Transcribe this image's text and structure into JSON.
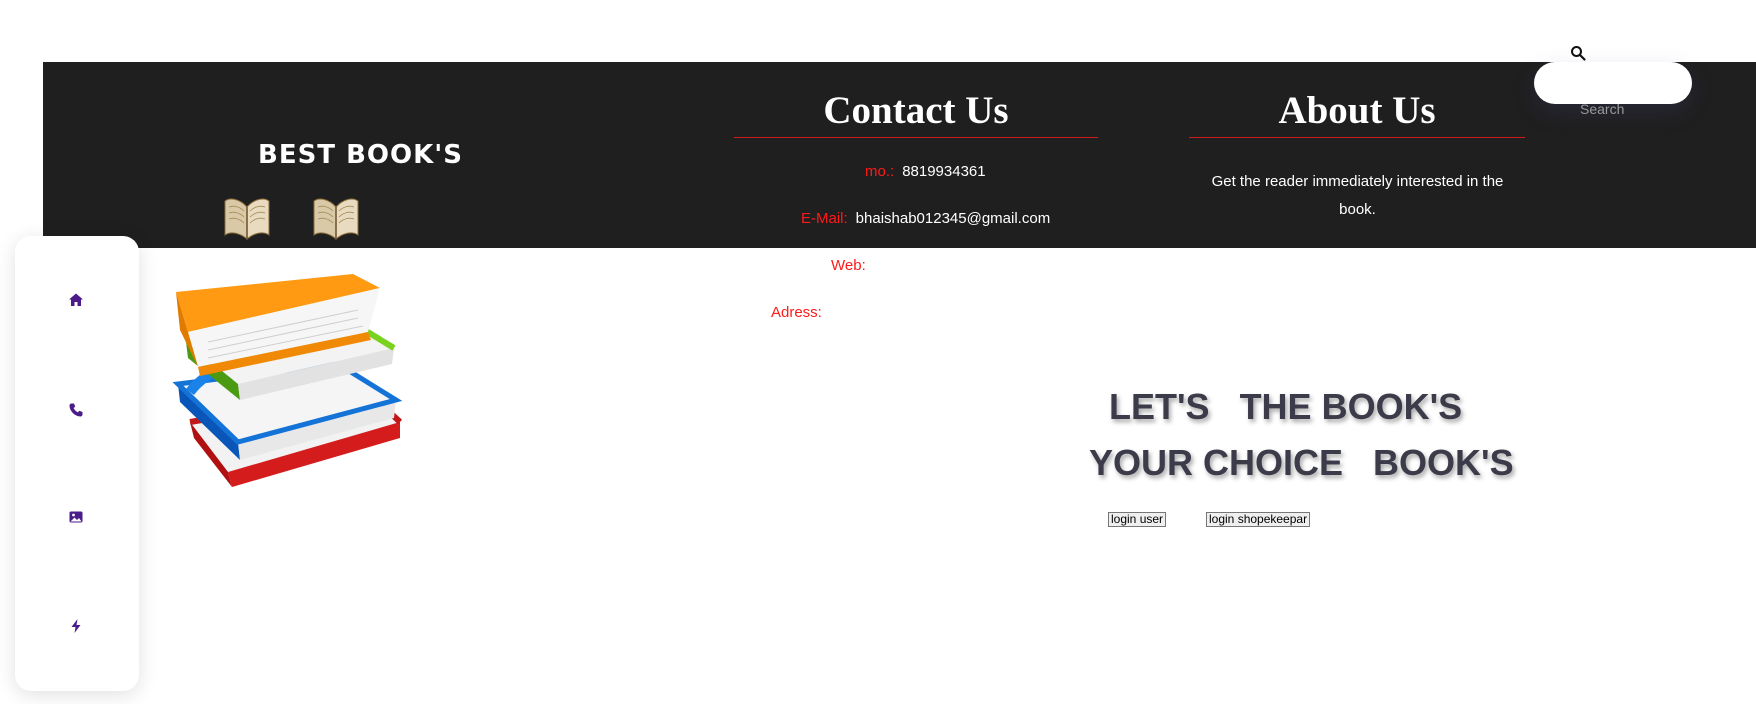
{
  "brand": {
    "title": "BEST BOOK'S"
  },
  "contact": {
    "heading": "Contact Us",
    "rows": [
      {
        "label": "mo.:",
        "value": "8819934361"
      },
      {
        "label": "E-Mail:",
        "value": "bhaishab012345@gmail.com"
      },
      {
        "label": "Web:",
        "value": ""
      },
      {
        "label": "Adress:",
        "value": ""
      }
    ]
  },
  "about": {
    "heading": "About Us",
    "text": "Get the reader immediately interested in the book."
  },
  "search": {
    "placeholder": "Search"
  },
  "sidebar": {
    "items": [
      {
        "icon": "home-icon"
      },
      {
        "icon": "phone-icon"
      },
      {
        "icon": "image-icon"
      },
      {
        "icon": "lightning-icon"
      }
    ]
  },
  "hero": {
    "line1": "LET'S   THE BOOK'S",
    "line2": "YOUR CHOICE   BOOK'S"
  },
  "buttons": {
    "login_user": "login user",
    "login_shopkeeper": "login shopekeepar"
  },
  "colors": {
    "header_bg": "#1f1f1f",
    "accent_red": "#ff1a1a",
    "icon_purple": "#4b1b8a",
    "hero_text": "#3b3b4a"
  }
}
